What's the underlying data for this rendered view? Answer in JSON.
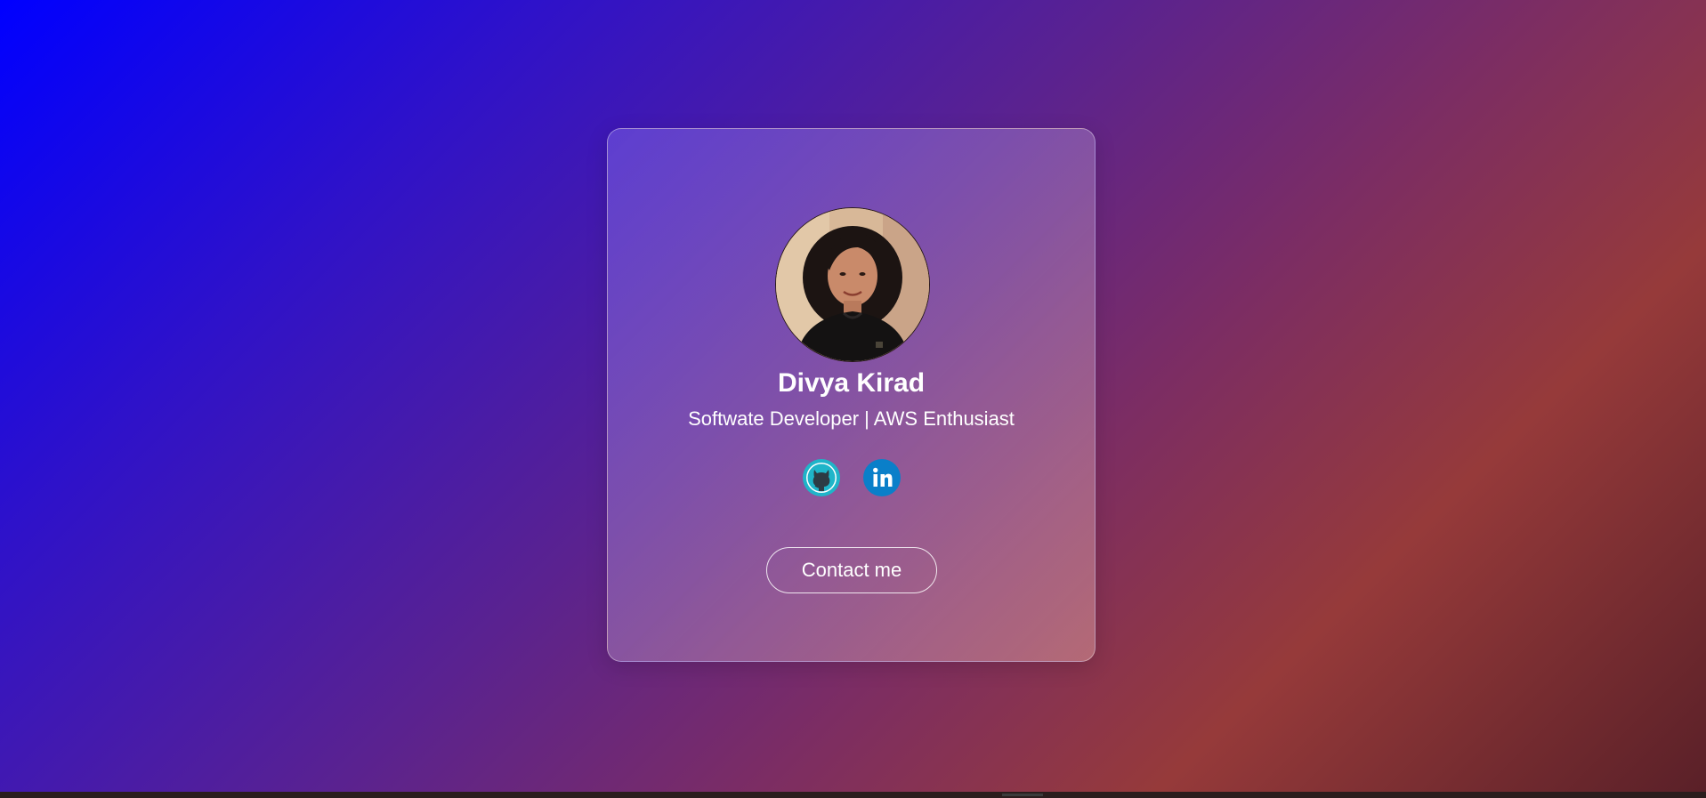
{
  "profile": {
    "name": "Divya Kirad",
    "tagline": "Softwate Developer | AWS Enthusiast",
    "avatar_icon": "profile-photo"
  },
  "socials": [
    {
      "icon": "github-icon",
      "color": "#1fb5c9"
    },
    {
      "icon": "linkedin-icon",
      "color": "#0a7fc9"
    }
  ],
  "actions": {
    "contact_label": "Contact me"
  },
  "colors": {
    "gradient_start": "#0000ff",
    "gradient_mid": "#5a2290",
    "gradient_end": "#963a3a"
  }
}
